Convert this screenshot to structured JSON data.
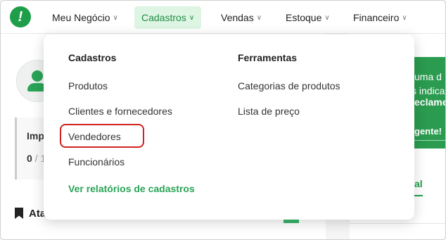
{
  "brand": {
    "logo_glyph": "!",
    "color": "#1f9e4a"
  },
  "nav": {
    "items": [
      {
        "label": "Meu Negócio"
      },
      {
        "label": "Cadastros"
      },
      {
        "label": "Vendas"
      },
      {
        "label": "Estoque"
      },
      {
        "label": "Financeiro"
      }
    ],
    "active_index": 1,
    "chevron": "chevron-down-icon"
  },
  "dropdown": {
    "cadastros": {
      "title": "Cadastros",
      "items": [
        "Produtos",
        "Clientes e fornecedores",
        "Vendedores",
        "Funcionários"
      ],
      "report_link": "Ver relatórios de cadastros"
    },
    "ferramentas": {
      "title": "Ferramentas",
      "items": [
        "Categorias de produtos",
        "Lista de preço"
      ]
    },
    "highlighted_item": "Vendedores"
  },
  "background": {
    "card": {
      "title": "Imp",
      "value": "0",
      "value_suffix": " / 1"
    },
    "section_title": "Ata",
    "promo": {
      "line1": "uma d",
      "line2": "s indica",
      "line3": "eclame",
      "cta": "gente!"
    },
    "tab_partial": "al"
  },
  "colors": {
    "accent": "#1f9e4a",
    "active_bg": "#def5e3",
    "highlight_border": "#d0231f"
  }
}
